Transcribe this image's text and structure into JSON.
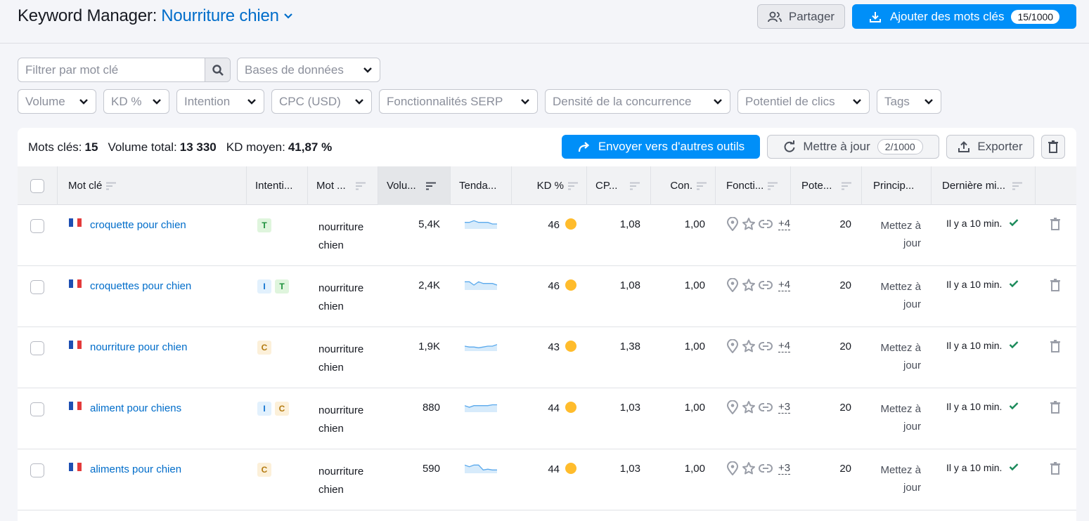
{
  "header": {
    "title_prefix": "Keyword Manager:",
    "project_name": "Nourriture chien",
    "share_label": "Partager",
    "add_label": "Ajouter des mots clés",
    "add_count": "15/1000"
  },
  "filters": {
    "search_placeholder": "Filtrer par mot clé",
    "databases_label": "Bases de données",
    "dropdowns": [
      "Volume",
      "KD %",
      "Intention",
      "CPC (USD)",
      "Fonctionnalités SERP",
      "Densité de la concurrence",
      "Potentiel de clics",
      "Tags"
    ]
  },
  "summary": {
    "keywords_label": "Mots clés:",
    "keywords_value": "15",
    "volume_label": "Volume total:",
    "volume_value": "13 330",
    "kd_label": "KD moyen:",
    "kd_value": "41,87 %"
  },
  "toolbar": {
    "send_label": "Envoyer vers d'autres outils",
    "update_label": "Mettre à jour",
    "update_count": "2/1000",
    "export_label": "Exporter"
  },
  "columns": [
    "Mot clé",
    "Intenti...",
    "Mot ...",
    "Volu...",
    "Tenda...",
    "KD %",
    "CP...",
    "Con.",
    "Foncti...",
    "Pote...",
    "Princip...",
    "Dernière mi..."
  ],
  "colors": {
    "accent": "#008ff8",
    "link": "#006dca",
    "kd_dot": "#ffbc2c",
    "check": "#1a8a5a"
  },
  "rows": [
    {
      "keyword": "croquette pour chien",
      "intents": [
        "T"
      ],
      "parent_line1": "nourriture",
      "parent_line2": "chien",
      "volume": "5,4K",
      "trend": [
        4,
        4,
        5,
        4,
        4,
        4,
        3,
        3
      ],
      "kd": "46",
      "cpc": "1,08",
      "com": "1,00",
      "serp_more": "+4",
      "potential": "20",
      "principal_line1": "Mettez à",
      "principal_line2": "jour",
      "updated": "Il y a 10 min."
    },
    {
      "keyword": "croquettes pour chien",
      "intents": [
        "I",
        "T"
      ],
      "parent_line1": "nourriture",
      "parent_line2": "chien",
      "volume": "2,4K",
      "trend": [
        5,
        5,
        3,
        5,
        4,
        4,
        4,
        3
      ],
      "kd": "46",
      "cpc": "1,08",
      "com": "1,00",
      "serp_more": "+4",
      "potential": "20",
      "principal_line1": "Mettez à",
      "principal_line2": "jour",
      "updated": "Il y a 10 min."
    },
    {
      "keyword": "nourriture pour chien",
      "intents": [
        "C"
      ],
      "parent_line1": "nourriture",
      "parent_line2": "chien",
      "volume": "1,9K",
      "trend": [
        3,
        2.5,
        2.5,
        2,
        2.5,
        3,
        3,
        4
      ],
      "kd": "43",
      "cpc": "1,38",
      "com": "1,00",
      "serp_more": "+4",
      "potential": "20",
      "principal_line1": "Mettez à",
      "principal_line2": "jour",
      "updated": "Il y a 10 min."
    },
    {
      "keyword": "aliment pour chiens",
      "intents": [
        "I",
        "C"
      ],
      "parent_line1": "nourriture",
      "parent_line2": "chien",
      "volume": "880",
      "trend": [
        4,
        3,
        4,
        4,
        4,
        4,
        4.5,
        4.5
      ],
      "kd": "44",
      "cpc": "1,03",
      "com": "1,00",
      "serp_more": "+3",
      "potential": "20",
      "principal_line1": "Mettez à",
      "principal_line2": "jour",
      "updated": "Il y a 10 min."
    },
    {
      "keyword": "aliments pour chien",
      "intents": [
        "C"
      ],
      "parent_line1": "nourriture",
      "parent_line2": "chien",
      "volume": "590",
      "trend": [
        5,
        4,
        5,
        5,
        2,
        2.5,
        2,
        2
      ],
      "kd": "44",
      "cpc": "1,03",
      "com": "1,00",
      "serp_more": "+3",
      "potential": "20",
      "principal_line1": "Mettez à",
      "principal_line2": "jour",
      "updated": "Il y a 10 min."
    }
  ]
}
